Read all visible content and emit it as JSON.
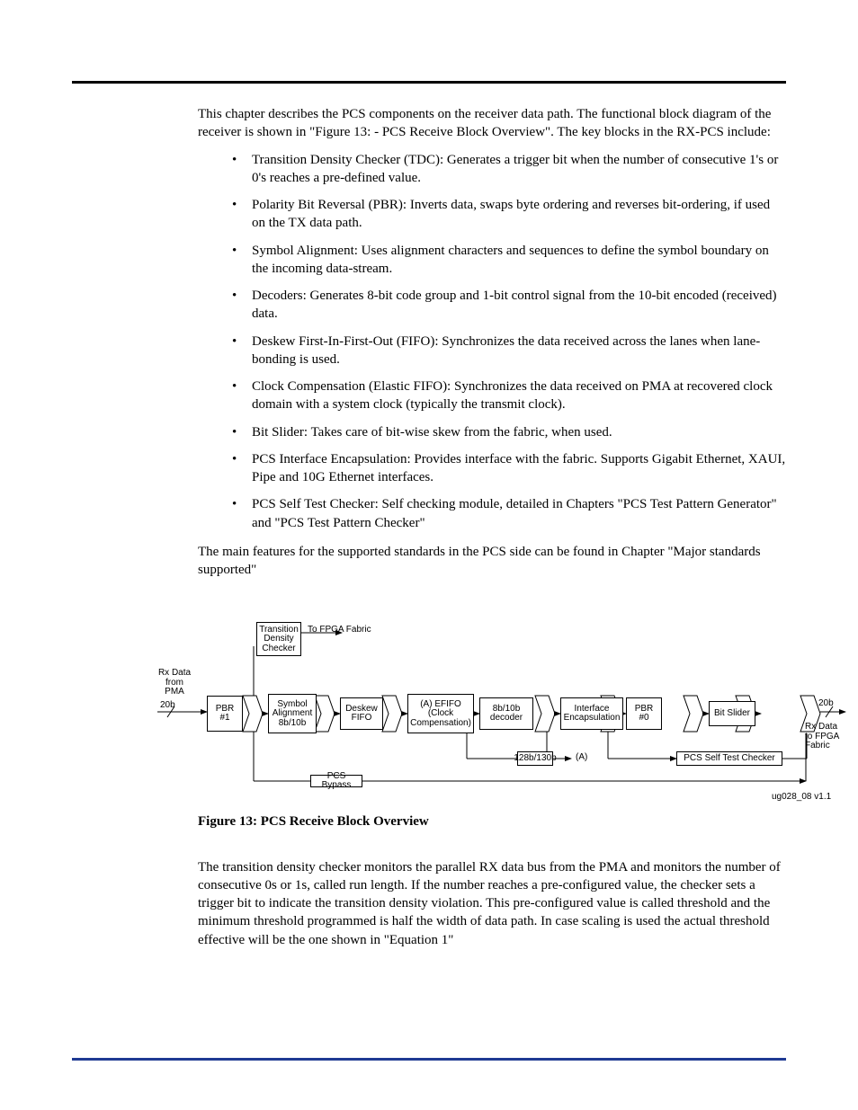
{
  "intro": "This chapter describes the PCS components on the receiver data path.  The functional block diagram of the receiver is shown in \"Figure 13: -  PCS Receive Block Overview\". The key blocks in the RX-PCS include:",
  "bullets": [
    "Transition Density Checker (TDC): Generates a trigger bit when the number of consecutive 1's or 0's reaches a pre-defined value.",
    "Polarity Bit Reversal (PBR): Inverts data, swaps byte ordering and reverses bit-ordering, if used on the TX data path.",
    "Symbol Alignment: Uses alignment characters and sequences to define the symbol boundary on the incoming data-stream.",
    "Decoders: Generates 8-bit code group and 1-bit control signal from the 10-bit encoded (received) data.",
    "Deskew First-In-First-Out (FIFO): Synchronizes the data received across the lanes when lane-bonding is used.",
    "Clock Compensation (Elastic FIFO): Synchronizes the data received on PMA at recovered clock domain with a system clock (typically the transmit clock).",
    "Bit Slider: Takes care of bit-wise skew from the fabric, when used.",
    "PCS Interface Encapsulation: Provides interface with the fabric. Supports Gigabit Ethernet, XAUI, Pipe and 10G Ethernet interfaces.",
    "PCS Self Test Checker: Self checking module, detailed in Chapters \"PCS Test Pattern Generator\" and \"PCS Test Pattern Checker\""
  ],
  "after_list": "The main features for the supported standards in the PCS side can be found in Chapter \"Major standards supported\"",
  "figure": {
    "caption": "Figure 13: PCS Receive Block Overview",
    "tag": "ug028_08 v1.1",
    "labels": {
      "tdc": "Transition\nDensity\nChecker",
      "to_fabric_top": "To FPGA Fabric",
      "rx_from_pma": "Rx Data\nfrom\nPMA",
      "twenty_b_in": "20b",
      "pbr1": "PBR\n#1",
      "symalign": "Symbol\nAlignment\n8b/10b",
      "deskew": "Deskew\nFIFO",
      "efifo": "(A) EFIFO\n(Clock\nCompensation)",
      "dec": "8b/10b\ndecoder",
      "encap": "Interface\nEncapsulation",
      "pbr0": "PBR\n#0",
      "bitslider": "Bit Slider",
      "twenty_b_out": "20b",
      "rx_to_fabric": "Rx Data\nto FPGA\nFabric",
      "lbl128": "128b/130b",
      "lblA": "(A)",
      "selftest": "PCS Self Test Checker",
      "pcs_bypass": "PCS Bypass"
    }
  },
  "section2": "The transition density checker monitors the parallel RX data bus from the PMA and monitors the number of consecutive 0s or 1s, called run length. If the number reaches a pre-configured value, the checker sets a trigger bit to indicate the transition density violation. This pre-configured value is called threshold and the minimum threshold programmed is half the width of data path. In case scaling is used the actual threshold effective will be the one shown in \"Equation 1\""
}
